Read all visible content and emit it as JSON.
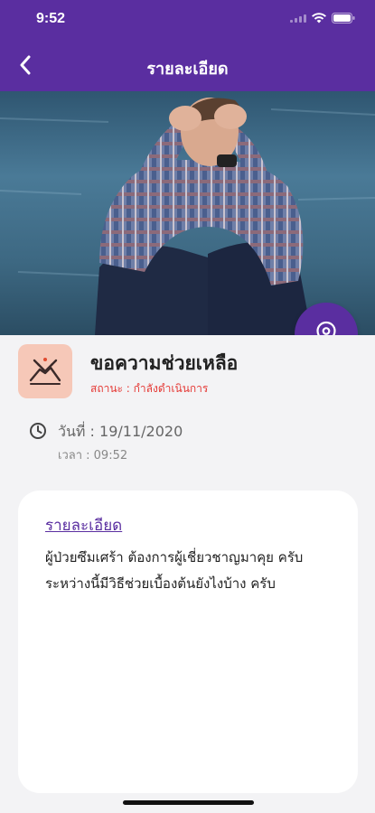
{
  "status_bar": {
    "time": "9:52"
  },
  "navbar": {
    "title": "รายละเอียด",
    "back_icon": "chevron-left-icon"
  },
  "hero": {
    "image_alt": "photo-man-distressed"
  },
  "request": {
    "title": "ขอความช่วยเหลือ",
    "status": "สถานะ : กำลังดำเนินการ",
    "date": "วันที่ : 19/11/2020",
    "time": "เวลา : 09:52",
    "category_icon": "handshake-icon"
  },
  "detail": {
    "heading": "รายละเอียด",
    "body": "ผู้ป่วยซึมเศร้า ต้องการผู้เชี่ยวชาญมาคุย ครับ ระหว่างนี้มีวิธีช่วยเบื้องต้นยังไงบ้าง ครับ"
  },
  "colors": {
    "primary": "#5a2ea0",
    "status": "#e53935",
    "tile": "#f6c8b8"
  }
}
